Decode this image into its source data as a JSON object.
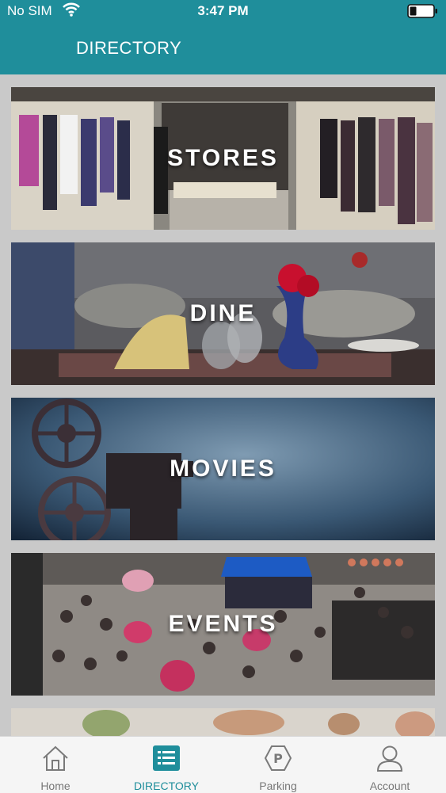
{
  "status_bar": {
    "carrier": "No SIM",
    "time": "3:47 PM"
  },
  "header": {
    "title": "DIRECTORY"
  },
  "tiles": [
    {
      "label": "STORES"
    },
    {
      "label": "DINE"
    },
    {
      "label": "MOVIES"
    },
    {
      "label": "EVENTS"
    }
  ],
  "tabbar": {
    "active_color": "#1f8e9b",
    "items": [
      {
        "label": "Home",
        "icon": "home-icon"
      },
      {
        "label": "DIRECTORY",
        "icon": "list-icon"
      },
      {
        "label": "Parking",
        "icon": "parking-icon"
      },
      {
        "label": "Account",
        "icon": "account-icon"
      }
    ]
  }
}
